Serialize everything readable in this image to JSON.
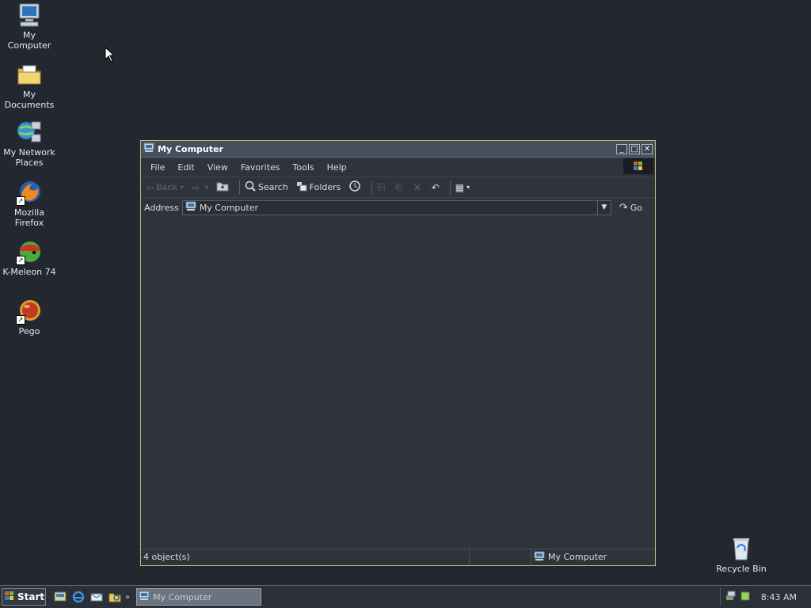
{
  "desktop": {
    "icons": [
      {
        "label": "My Computer"
      },
      {
        "label": "My Documents"
      },
      {
        "label": "My Network Places"
      },
      {
        "label": "Mozilla Firefox"
      },
      {
        "label": "K-Meleon 74"
      },
      {
        "label": "Pego"
      },
      {
        "label": "Recycle Bin"
      }
    ]
  },
  "window": {
    "title": "My Computer",
    "menu": [
      "File",
      "Edit",
      "View",
      "Favorites",
      "Tools",
      "Help"
    ],
    "toolbar": {
      "back": "Back",
      "search": "Search",
      "folders": "Folders"
    },
    "address": {
      "label": "Address",
      "value": "My Computer",
      "go": "Go"
    },
    "status": {
      "objects": "4 object(s)",
      "location": "My Computer"
    }
  },
  "taskbar": {
    "start": "Start",
    "tasks": [
      {
        "label": "My Computer"
      }
    ],
    "clock": "8:43 AM"
  }
}
